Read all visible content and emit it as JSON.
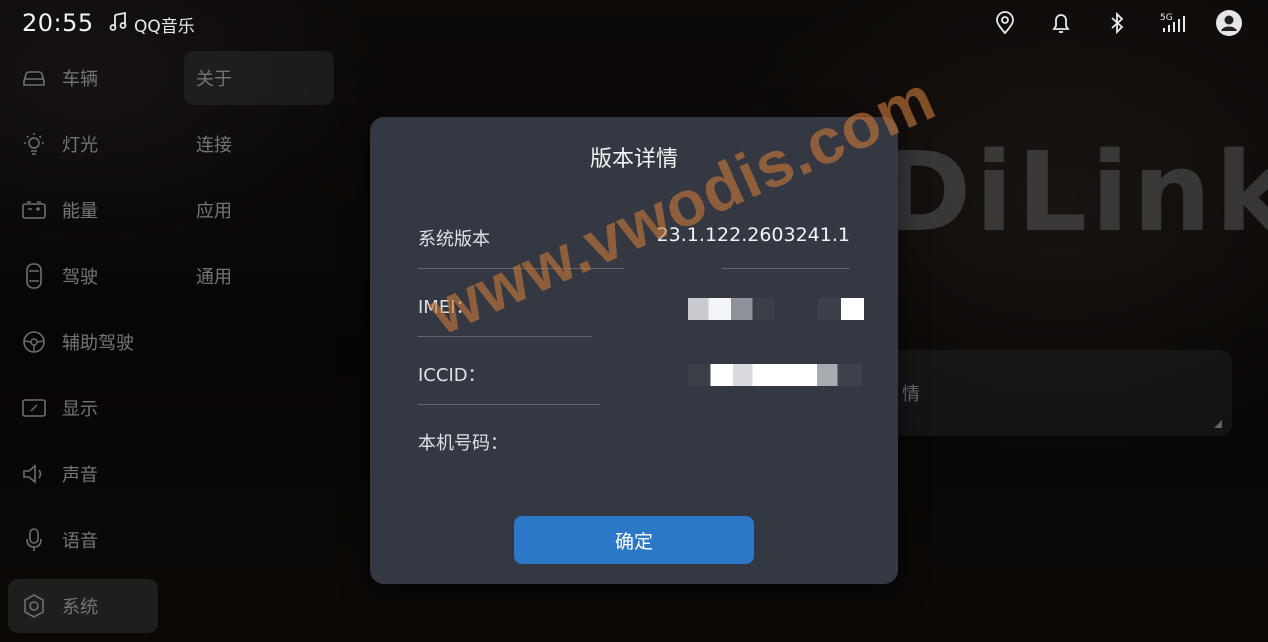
{
  "status_bar": {
    "time": "20:55",
    "media_app": "QQ音乐",
    "signal_label": "5G",
    "icons": [
      "location-icon",
      "bell-icon",
      "bluetooth-icon",
      "signal-icon",
      "user-avatar-icon"
    ]
  },
  "nav": {
    "items": [
      {
        "label": "车辆",
        "icon": "car-icon"
      },
      {
        "label": "灯光",
        "icon": "light-icon"
      },
      {
        "label": "能量",
        "icon": "battery-icon"
      },
      {
        "label": "驾驶",
        "icon": "driving-icon"
      },
      {
        "label": "辅助驾驶",
        "icon": "steering-wheel-icon"
      },
      {
        "label": "显示",
        "icon": "display-icon"
      },
      {
        "label": "声音",
        "icon": "speaker-icon"
      },
      {
        "label": "语音",
        "icon": "microphone-icon"
      },
      {
        "label": "系统",
        "icon": "settings-icon",
        "active": true
      }
    ]
  },
  "subnav": {
    "items": [
      {
        "label": "关于",
        "active": true
      },
      {
        "label": "连接"
      },
      {
        "label": "应用"
      },
      {
        "label": "通用"
      }
    ]
  },
  "background": {
    "brand_text": "DiLink",
    "card_label": "情"
  },
  "dialog": {
    "title": "版本详情",
    "rows": [
      {
        "label": "系统版本",
        "value": "23.1.122.2603241.1"
      },
      {
        "label": "IMEI：",
        "value": ""
      },
      {
        "label": "ICCID：",
        "value": ""
      },
      {
        "label": "本机号码：",
        "value": ""
      }
    ],
    "confirm_label": "确定"
  },
  "watermark": "www.vwodis.com",
  "colors": {
    "dialog_bg": "#333842",
    "confirm_button": "#2c78c8",
    "watermark": "#c8783a"
  }
}
